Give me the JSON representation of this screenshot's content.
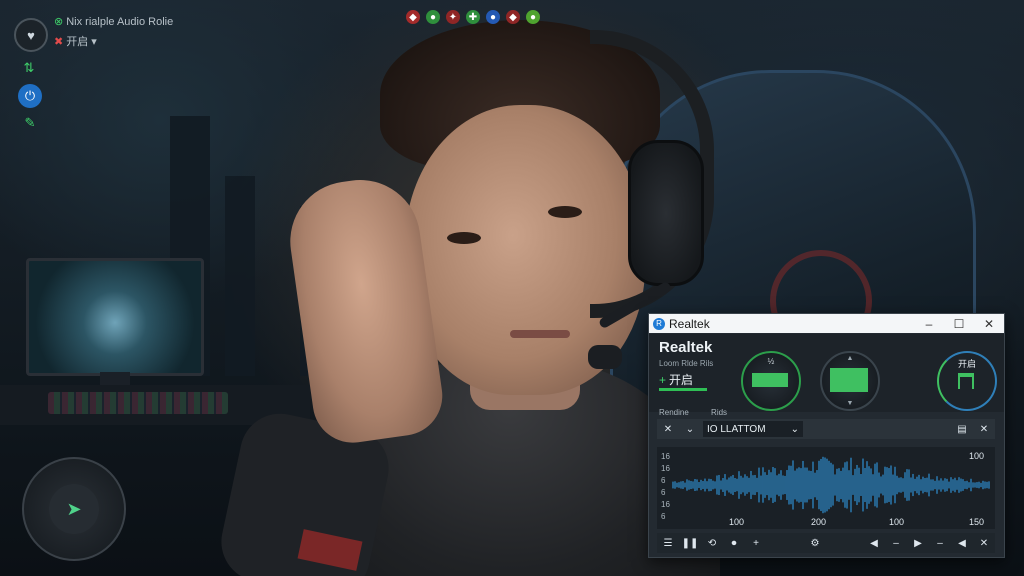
{
  "hud": {
    "title": "Nix rialple Audio Rolie",
    "status": "开启",
    "status_icon": "flag-icon",
    "buttons": [
      "heart-icon",
      "signal-icon",
      "power-icon",
      "wrench-icon"
    ],
    "top_icons": [
      {
        "icon": "shield-icon",
        "color": "#d33b3b"
      },
      {
        "icon": "leaf-icon",
        "color": "#3cb44b"
      },
      {
        "icon": "star-icon",
        "color": "#c23a3a"
      },
      {
        "icon": "plus-icon",
        "color": "#3cb44b"
      },
      {
        "icon": "orb-icon",
        "color": "#2c6fd1"
      },
      {
        "icon": "gem-icon",
        "color": "#c23a3a"
      },
      {
        "icon": "leaf-icon",
        "color": "#5ec23a"
      }
    ],
    "joystick_icon": "compass-icon"
  },
  "window": {
    "title": "Realtek",
    "minimize": "–",
    "maximize": "☐",
    "close": "✕",
    "brand": "Realtek",
    "subtitle": "Loom Rlde Rils",
    "toggle_label": "开启",
    "knob1_label": "½",
    "knob3_label": "开启",
    "tabs": [
      "Rendine",
      "Rids"
    ],
    "device": "IO LLATTOM",
    "waveform": {
      "left_labels": [
        "16",
        "16",
        "6",
        "6",
        "16",
        "6"
      ],
      "right_label": "100",
      "x_labels": [
        "100",
        "200",
        "100",
        "150"
      ],
      "accent": "#2f8ecf"
    }
  }
}
